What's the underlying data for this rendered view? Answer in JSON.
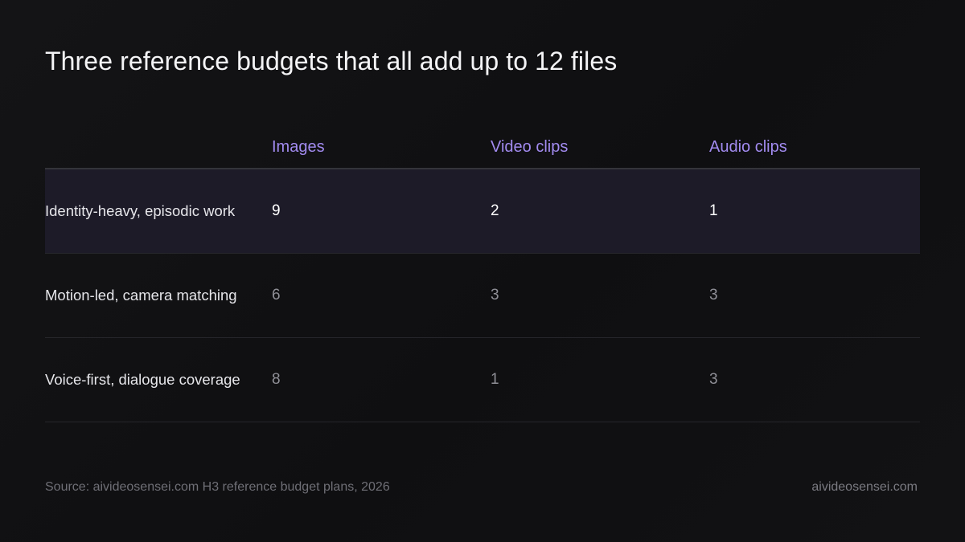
{
  "title": "Three reference budgets that all add up to 12 files",
  "colors": {
    "background": "#121214",
    "header_accent": "#a28bf0",
    "highlight_row": "#1d1b28",
    "muted_value": "#8f8f96"
  },
  "chart_data": {
    "type": "table",
    "title": "Three reference budgets that all add up to 12 files",
    "columns": [
      "",
      "Images",
      "Video clips",
      "Audio clips"
    ],
    "rows": [
      {
        "label": "Identity-heavy, episodic work",
        "values": [
          "9",
          "2",
          "1"
        ],
        "highlighted": true
      },
      {
        "label": "Motion-led, camera matching",
        "values": [
          "6",
          "3",
          "3"
        ],
        "highlighted": false
      },
      {
        "label": "Voice-first, dialogue coverage",
        "values": [
          "8",
          "1",
          "3"
        ],
        "highlighted": false
      }
    ]
  },
  "footer": {
    "source": "Source: aivideosensei.com H3 reference budget plans, 2026",
    "site": "aivideosensei.com"
  }
}
